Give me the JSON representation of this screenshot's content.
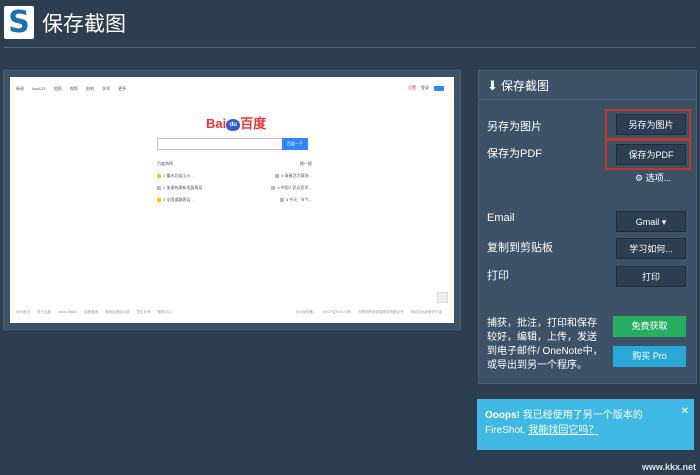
{
  "header": {
    "logo_letter": "S",
    "title": "保存截图"
  },
  "preview": {
    "topnav": [
      "新闻",
      "hao123",
      "地图",
      "视频",
      "贴吧",
      "学术",
      "更多"
    ],
    "topright_red": "设置",
    "topright_text": "登录",
    "logo_text_a": "Bai",
    "logo_text_paw": "du",
    "logo_text_b": "百度",
    "search_button": "百度一下",
    "hot_title": "百度热榜",
    "hot_refresh": "换一换",
    "hot_items": [
      [
        "1 重庆北碚山火...",
        "4 青春活力赛场..."
      ],
      [
        "2 加速构建新发展格局",
        "5 中国人民志愿军..."
      ],
      [
        "3 全国道路客运...",
        "6 今天 · 节气..."
      ]
    ],
    "footer_left": [
      "设为首页",
      "关于百度",
      "About Baidu",
      "百度营销",
      "使用百度前必读",
      "意见反馈",
      "帮助中心"
    ],
    "footer_right": [
      "京公网安备...",
      "京ICP证030173号",
      "互联网药品信息服务资格证书",
      "网络文化经营许可证"
    ]
  },
  "panel": {
    "title": "保存截图",
    "save_image_label": "另存为图片",
    "save_image_button": "另存为图片",
    "save_pdf_label": "保存为PDF",
    "save_pdf_button": "保存为PDF",
    "settings": "⚙ 选项...",
    "email_label": "Email",
    "email_button": "Gmail ▾",
    "clipboard_label": "复制到剪贴板",
    "clipboard_button": "学习如何...",
    "print_label": "打印",
    "print_button": "打印",
    "desc": "捕获，批注，打印和保存较好，编辑，上传，发送到电子邮件/ OneNote中，或导出到另一个程序。",
    "free_button": "免费获取",
    "buy_button": "购买 Pro"
  },
  "notice": {
    "bold": "Ooops!",
    "text": " 我已经使用了另一个版本的 FireShot. ",
    "link": "我能找回它吗？",
    "close": "✕"
  },
  "watermark": "www.kkx.net"
}
